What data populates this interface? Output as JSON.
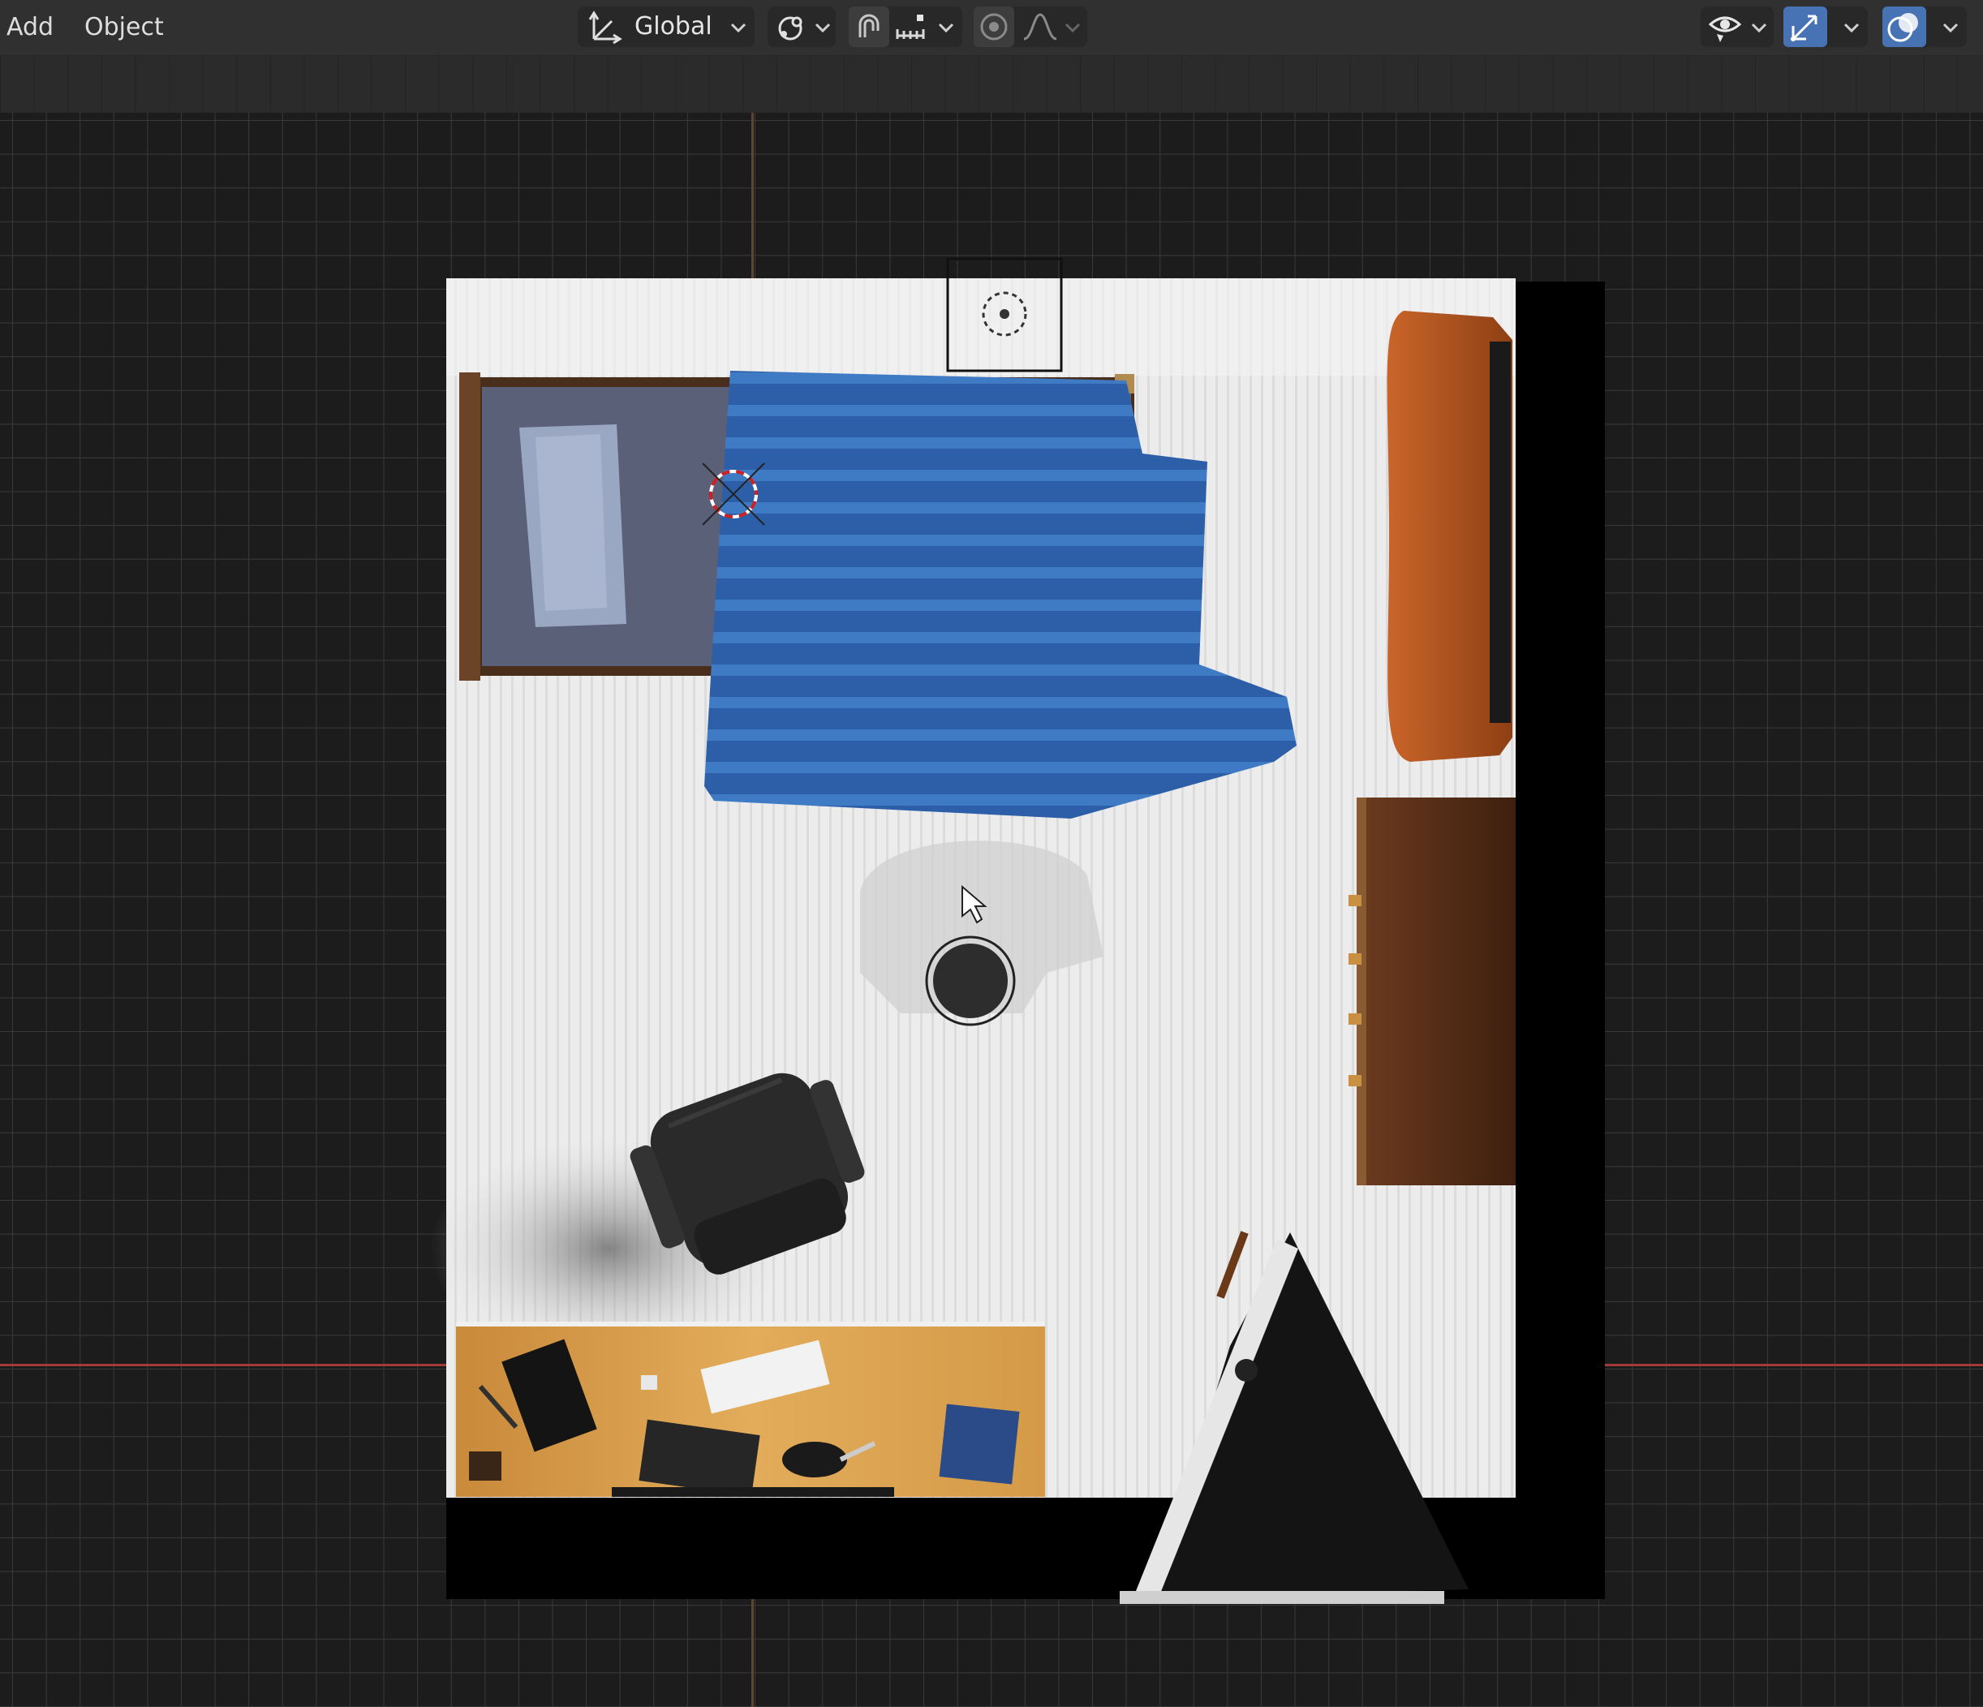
{
  "header": {
    "menu": [
      {
        "label": "Add"
      },
      {
        "label": "Object"
      }
    ],
    "transform_orientation": {
      "label": "Global",
      "icon": "orientation-icon"
    },
    "pivot": {
      "icon": "pivot-point-icon"
    },
    "snap": {
      "icon": "snap-magnet-icon",
      "increment_icon": "snap-increment-icon"
    },
    "proportional": {
      "icon": "proportional-editing-icon",
      "falloff_icon": "falloff-curve-icon"
    },
    "right": [
      {
        "icon": "visibility-eye-icon"
      },
      {
        "icon": "gizmo-icon"
      },
      {
        "icon": "overlay-icon"
      }
    ]
  },
  "colors": {
    "accent": "#4772b3",
    "header_bg": "#303030",
    "grid_line": "#3a3a3a",
    "x_axis": "#a33a3a",
    "y_axis": "#5b4630",
    "floor": "#ededed",
    "wall": "#000000",
    "blanket": "#2f62ad",
    "desk": "#d9a455",
    "dresser": "#5a2f18",
    "tv_stand": "#b4561d"
  },
  "scene": {
    "objects": [
      "bed",
      "pillow",
      "blanket",
      "tv-stand",
      "dresser",
      "office-chair",
      "desk",
      "keyboard",
      "notebook",
      "laptop",
      "mouse",
      "books",
      "easel",
      "light-object",
      "camera-object",
      "3d-cursor"
    ]
  }
}
